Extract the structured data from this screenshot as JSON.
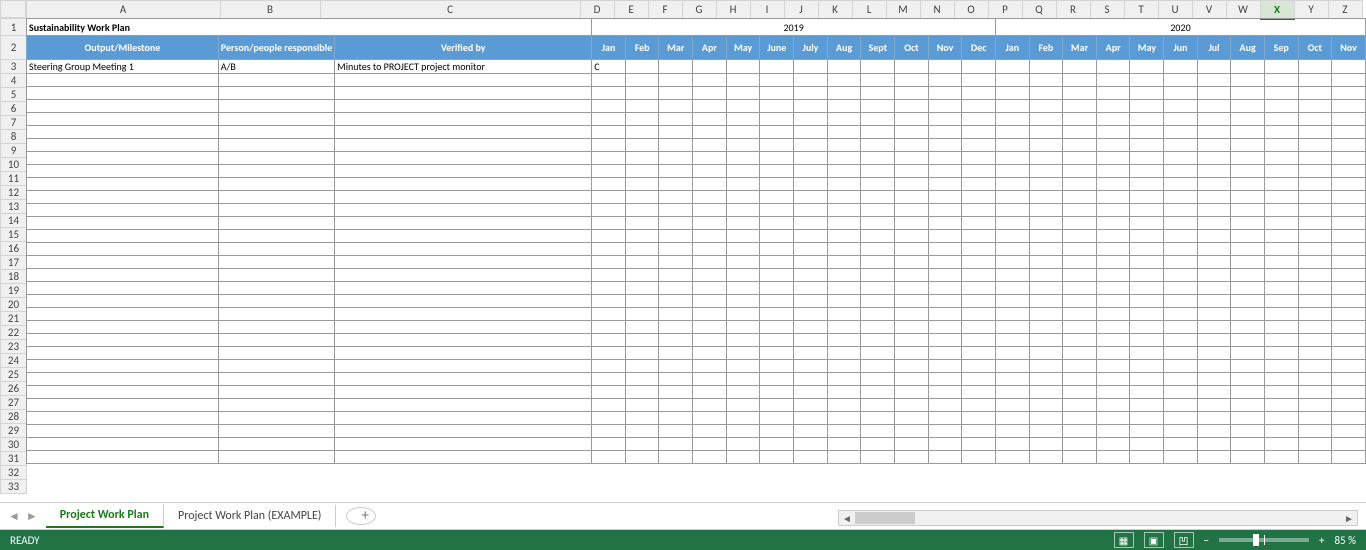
{
  "columns": [
    "A",
    "B",
    "C",
    "D",
    "E",
    "F",
    "G",
    "H",
    "I",
    "J",
    "K",
    "L",
    "M",
    "N",
    "O",
    "P",
    "Q",
    "R",
    "S",
    "T",
    "U",
    "V",
    "W",
    "X",
    "Y",
    "Z"
  ],
  "col_widths": {
    "A": 194,
    "B": 100,
    "C": 260,
    "default": 34
  },
  "active_column": "X",
  "row_count": 33,
  "row1": {
    "title": "Sustainability Work Plan",
    "year1": "2019",
    "year2": "2020"
  },
  "headers": {
    "output": "Output/Milestone",
    "person": "Person/people responsible",
    "verified": "Verified by",
    "months": [
      "Jan",
      "Feb",
      "Mar",
      "Apr",
      "May",
      "June",
      "July",
      "Aug",
      "Sept",
      "Oct",
      "Nov",
      "Dec",
      "Jan",
      "Feb",
      "Mar",
      "Apr",
      "May",
      "Jun",
      "Jul",
      "Aug",
      "Sep",
      "Oct",
      "Nov"
    ]
  },
  "data_row": {
    "A": "Steering Group Meeting 1",
    "B": "A/B",
    "C": "Minutes to PROJECT project monitor",
    "D": "C"
  },
  "tabs": {
    "active": "Project Work Plan",
    "other": "Project Work Plan (EXAMPLE)"
  },
  "status": {
    "ready": "READY",
    "zoom": "85 %"
  }
}
